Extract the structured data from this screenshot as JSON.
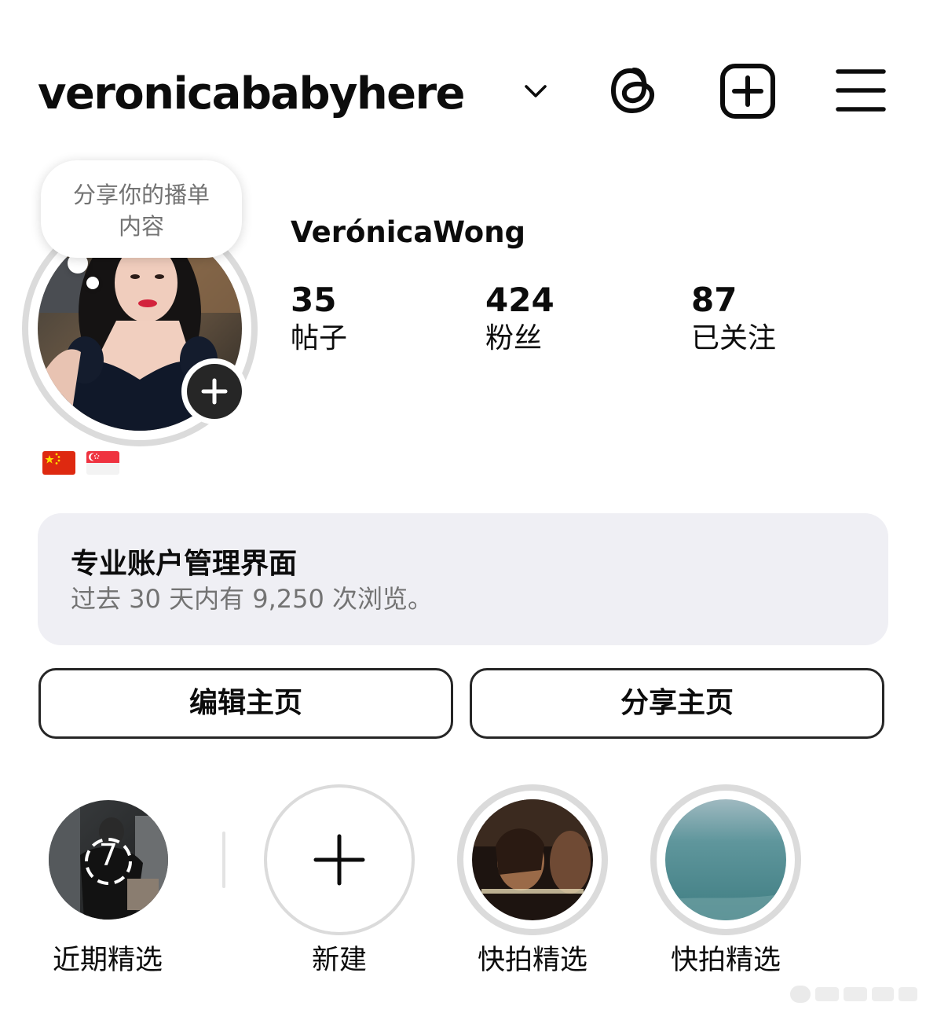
{
  "header": {
    "username": "veronicababyhere",
    "chevron_icon": "chevron-down-icon",
    "threads_icon": "threads-icon",
    "create_icon": "plus-square-icon",
    "menu_icon": "hamburger-menu-icon"
  },
  "note": {
    "line1": "分享你的播单",
    "line2": "内容"
  },
  "profile": {
    "display_name": "VerónicaWong",
    "flags": [
      "🇨🇳",
      "🇸🇬"
    ],
    "stats": [
      {
        "value": "35",
        "label": "帖子"
      },
      {
        "value": "424",
        "label": "粉丝"
      },
      {
        "value": "87",
        "label": "已关注"
      }
    ]
  },
  "dashboard": {
    "title": "专业账户管理界面",
    "subtitle": "过去 30 天内有 9,250 次浏览。"
  },
  "buttons": {
    "edit": "编辑主页",
    "share": "分享主页"
  },
  "highlights": [
    {
      "label": "近期精选",
      "badge": "7"
    },
    {
      "label": "新建"
    },
    {
      "label": "快拍精选"
    },
    {
      "label": "快拍精选"
    }
  ],
  "colors": {
    "text": "#0c0c0c",
    "muted": "#737373",
    "card_bg": "#efeff4",
    "ring": "#dbdbdb",
    "button_border": "#262626"
  }
}
